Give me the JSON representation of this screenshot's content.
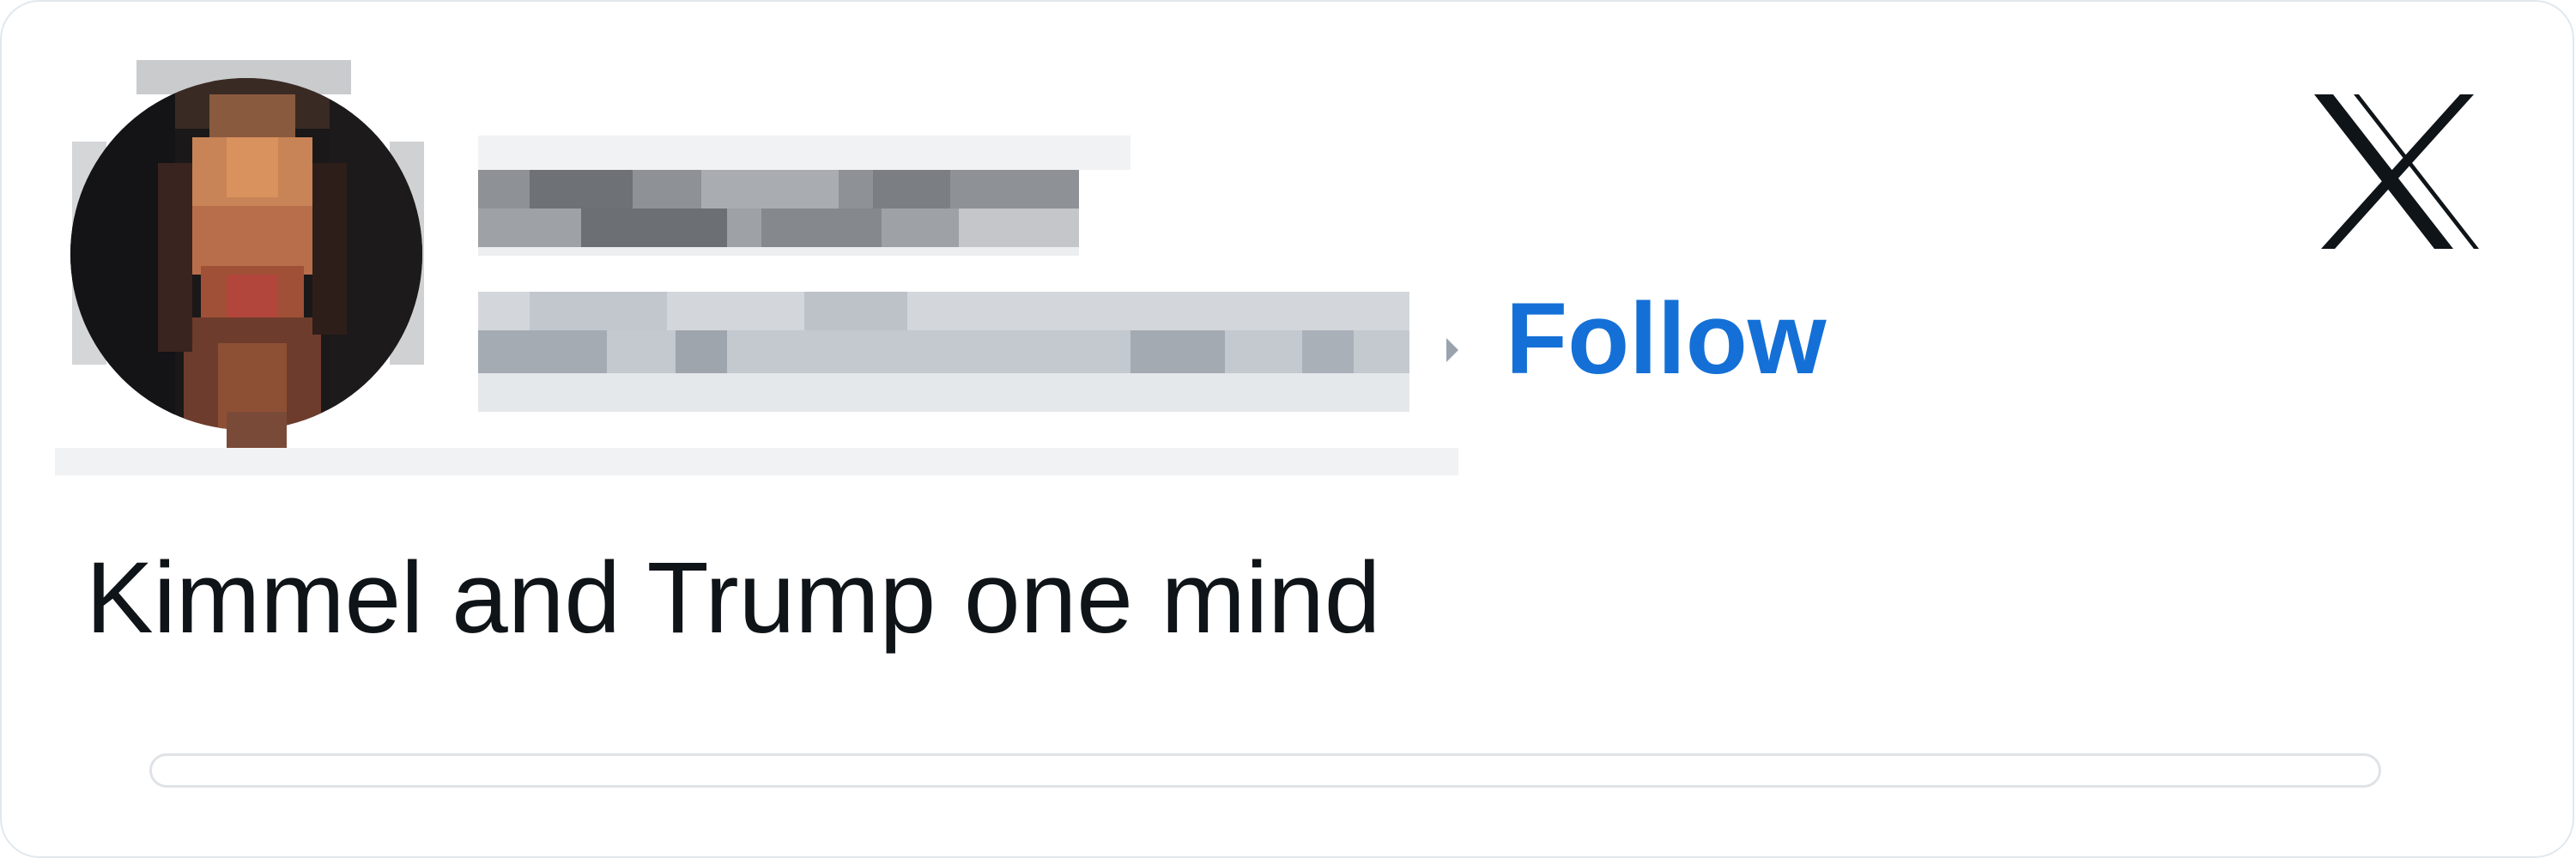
{
  "tweet": {
    "author": {
      "avatar_icon": "user-avatar-icon",
      "name": "",
      "handle": ""
    },
    "follow_label": "Follow",
    "logo_icon": "x-logo-icon",
    "text": "Kimmel and Trump one mind"
  },
  "colors": {
    "follow": "#1470d6",
    "text": "#0f1419",
    "border": "#e1e8ed",
    "logo": "#0f1419"
  }
}
